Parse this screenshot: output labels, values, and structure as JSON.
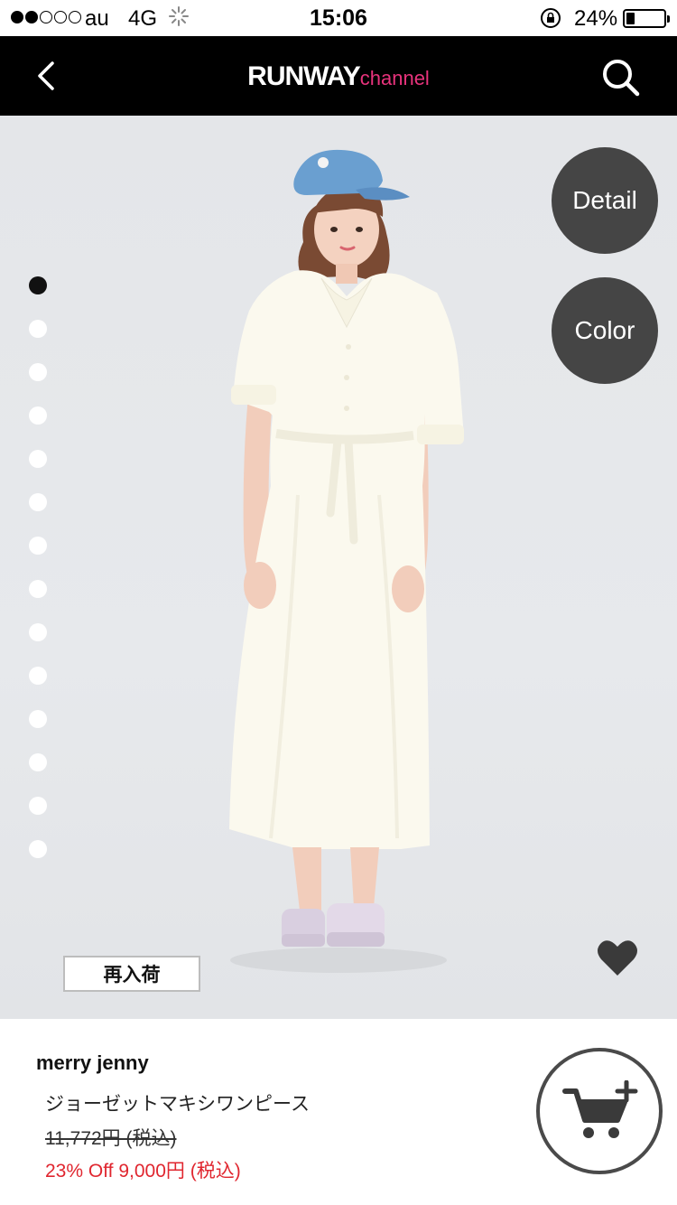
{
  "status_bar": {
    "carrier": "au",
    "network": "4G",
    "time": "15:06",
    "battery_percent": "24%",
    "battery_level": 0.24,
    "signal_bars_filled": 2,
    "signal_bars_total": 5
  },
  "nav": {
    "brand_main": "RUNWAY",
    "brand_sub": "channel",
    "back_icon": "chevron-left-icon",
    "search_icon": "search-icon"
  },
  "hero": {
    "detail_label": "Detail",
    "color_label": "Color",
    "restock_label": "再入荷",
    "image_count": 14,
    "active_image": 1,
    "favorite_icon": "heart-icon"
  },
  "product": {
    "brand": "merry jenny",
    "name": "ジョーゼットマキシワンピース",
    "original_price": "11,772円 (税込)",
    "sale_price": "23% Off 9,000円 (税込)",
    "cart_icon": "cart-add-icon"
  },
  "colors": {
    "nav_background": "#000000",
    "brand_accent": "#e8337c",
    "sale_red": "#e0262f",
    "round_button": "#454545"
  }
}
